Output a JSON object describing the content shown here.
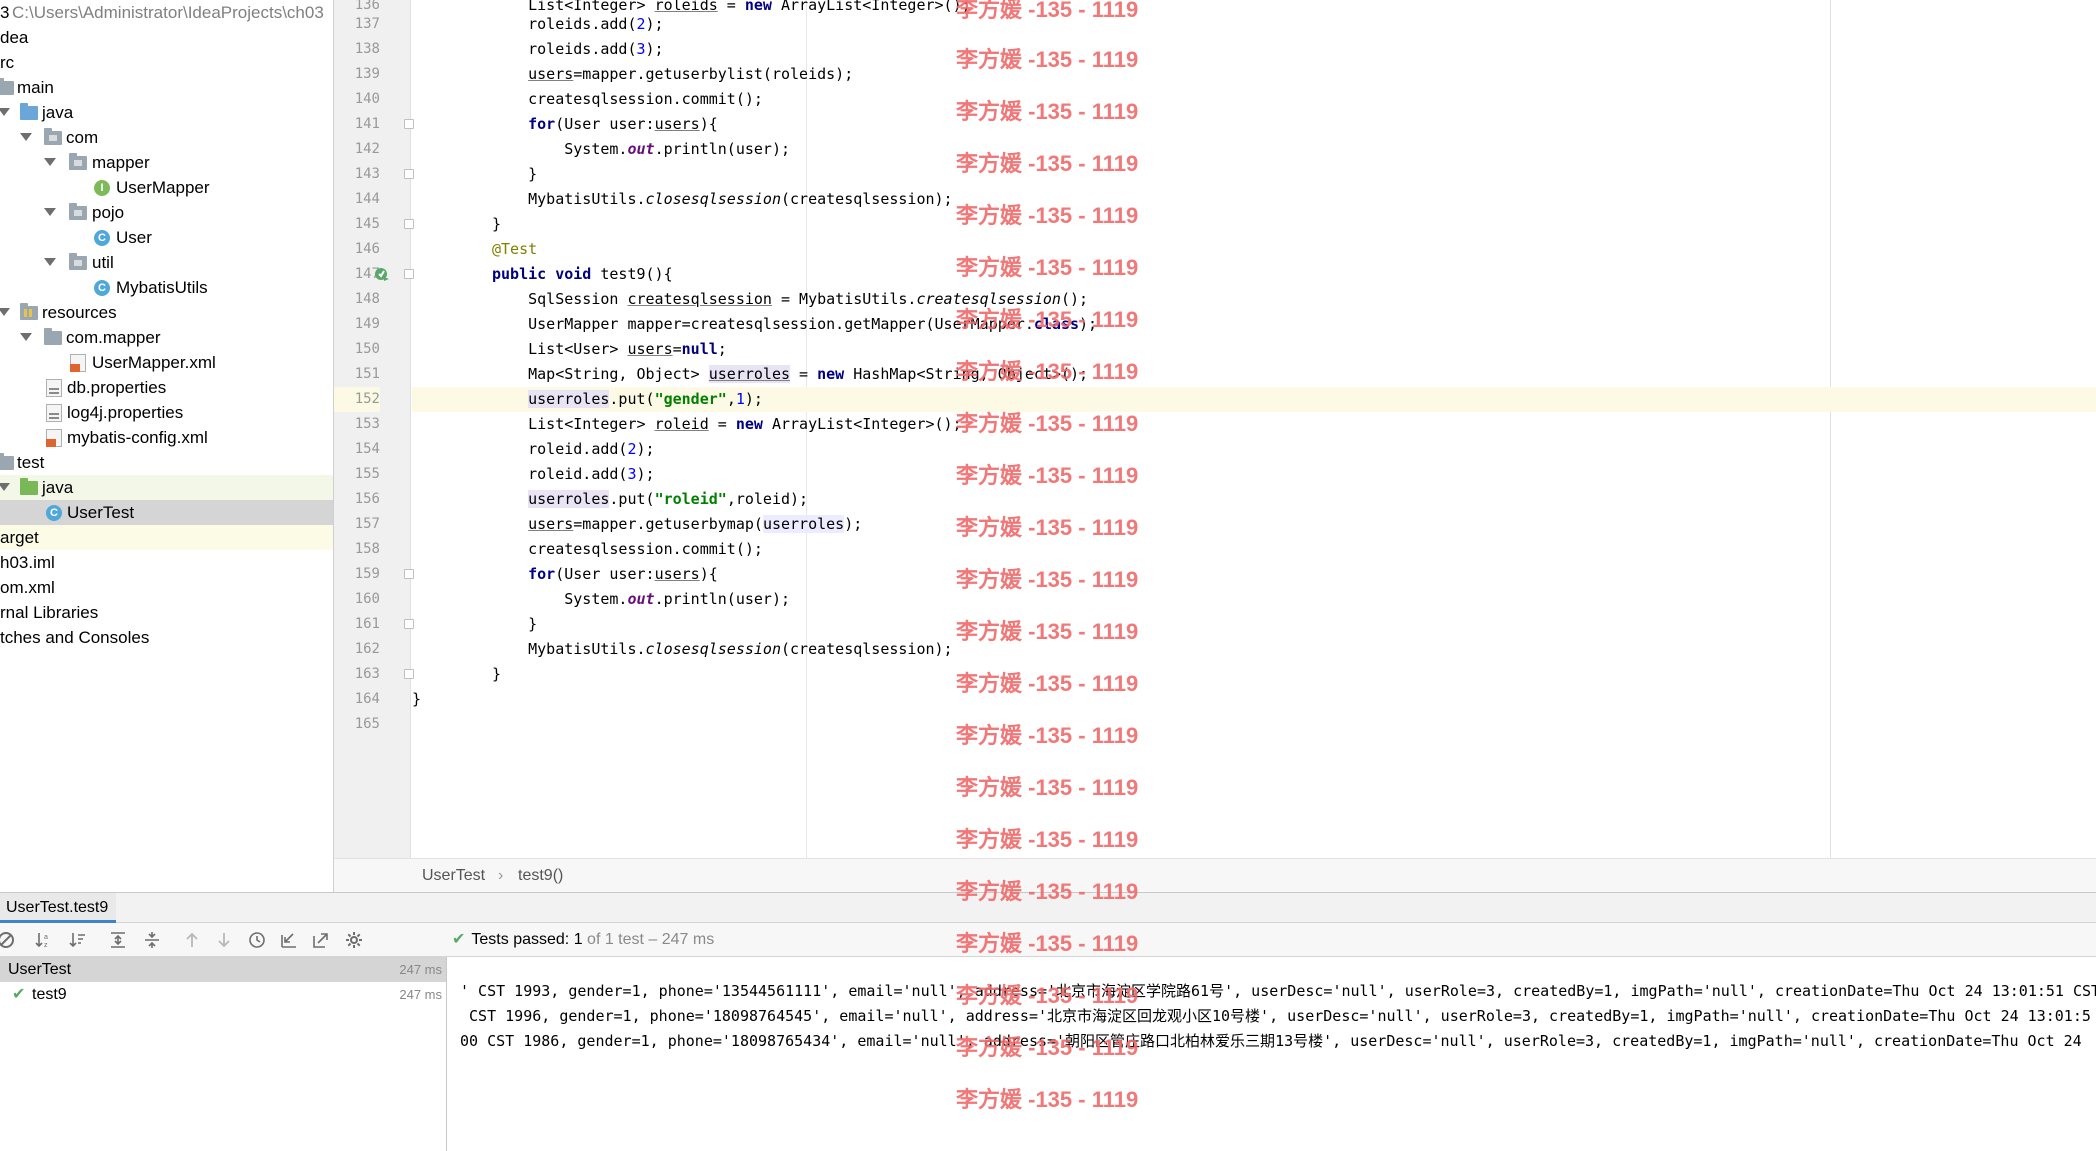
{
  "project": {
    "root_path": "C:\\Users\\Administrator\\IdeaProjects\\ch03",
    "items": [
      {
        "label": "3",
        "extra": "C:\\Users\\Administrator\\IdeaProjects\\ch03"
      },
      {
        "label": "dea"
      },
      {
        "label": "rc"
      },
      {
        "label": "main"
      },
      {
        "label": "java"
      },
      {
        "label": "com"
      },
      {
        "label": "mapper"
      },
      {
        "label": "UserMapper"
      },
      {
        "label": "pojo"
      },
      {
        "label": "User"
      },
      {
        "label": "util"
      },
      {
        "label": "MybatisUtils"
      },
      {
        "label": "resources"
      },
      {
        "label": "com.mapper"
      },
      {
        "label": "UserMapper.xml"
      },
      {
        "label": "db.properties"
      },
      {
        "label": "log4j.properties"
      },
      {
        "label": "mybatis-config.xml"
      },
      {
        "label": "test"
      },
      {
        "label": "java"
      },
      {
        "label": "UserTest"
      },
      {
        "label": "arget"
      },
      {
        "label": "h03.iml"
      },
      {
        "label": "om.xml"
      },
      {
        "label": "rnal Libraries"
      },
      {
        "label": "tches and Consoles"
      }
    ]
  },
  "editor": {
    "line_numbers": [
      "136",
      "137",
      "138",
      "139",
      "140",
      "141",
      "142",
      "143",
      "144",
      "145",
      "146",
      "147",
      "148",
      "149",
      "150",
      "151",
      "152",
      "153",
      "154",
      "155",
      "156",
      "157",
      "158",
      "159",
      "160",
      "161",
      "162",
      "163",
      "164",
      "165"
    ],
    "current_line": "152"
  },
  "breadcrumb": {
    "class_name": "UserTest",
    "method_name": "test9()"
  },
  "run": {
    "tab_label": "UserTest.test9",
    "status_prefix": "Tests passed:",
    "passed_count": "1",
    "status_suffix": "of 1 test – 247 ms",
    "tree": [
      {
        "label": "UserTest",
        "time": "247 ms"
      },
      {
        "label": "test9",
        "time": "247 ms"
      }
    ],
    "console_lines": [
      "' CST 1993, gender=1, phone='13544561111', email='null', address='北京市海淀区学院路61号', userDesc='null', userRole=3, createdBy=1, imgPath='null', creationDate=Thu Oct 24 13:01:51 CST",
      " CST 1996, gender=1, phone='18098764545', email='null', address='北京市海淀区回龙观小区10号楼', userDesc='null', userRole=3, createdBy=1, imgPath='null', creationDate=Thu Oct 24 13:01:5",
      "00 CST 1986, gender=1, phone='18098765434', email='null', address='朝阳区管庄路口北柏林爱乐三期13号楼', userDesc='null', userRole=3, createdBy=1, imgPath='null', creationDate=Thu Oct 24"
    ]
  },
  "watermark": {
    "text": "李方媛 -135 - 1119"
  },
  "colors": {
    "accent": "#4083c9",
    "pass_green": "#59a869",
    "watermark": "#f06a6a"
  }
}
